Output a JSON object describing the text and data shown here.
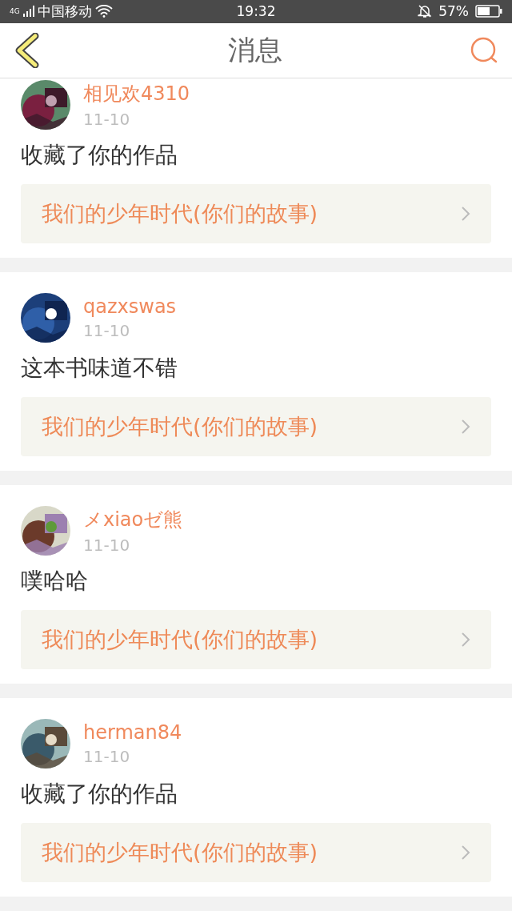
{
  "status_bar": {
    "network": "4G",
    "carrier": "中国移动",
    "time": "19:32",
    "battery": "57%"
  },
  "header": {
    "title": "消息"
  },
  "messages": [
    {
      "user": "相见欢4310",
      "date": "11-10",
      "text": "收藏了你的作品",
      "work": "我们的少年时代(你们的故事)"
    },
    {
      "user": "qazxswas",
      "date": "11-10",
      "text": "这本书味道不错",
      "work": "我们的少年时代(你们的故事)"
    },
    {
      "user": "メxiaoゼ熊",
      "date": "11-10",
      "text": "噗哈哈",
      "work": "我们的少年时代(你们的故事)"
    },
    {
      "user": "herman84",
      "date": "11-10",
      "text": "收藏了你的作品",
      "work": "我们的少年时代(你们的故事)"
    }
  ]
}
